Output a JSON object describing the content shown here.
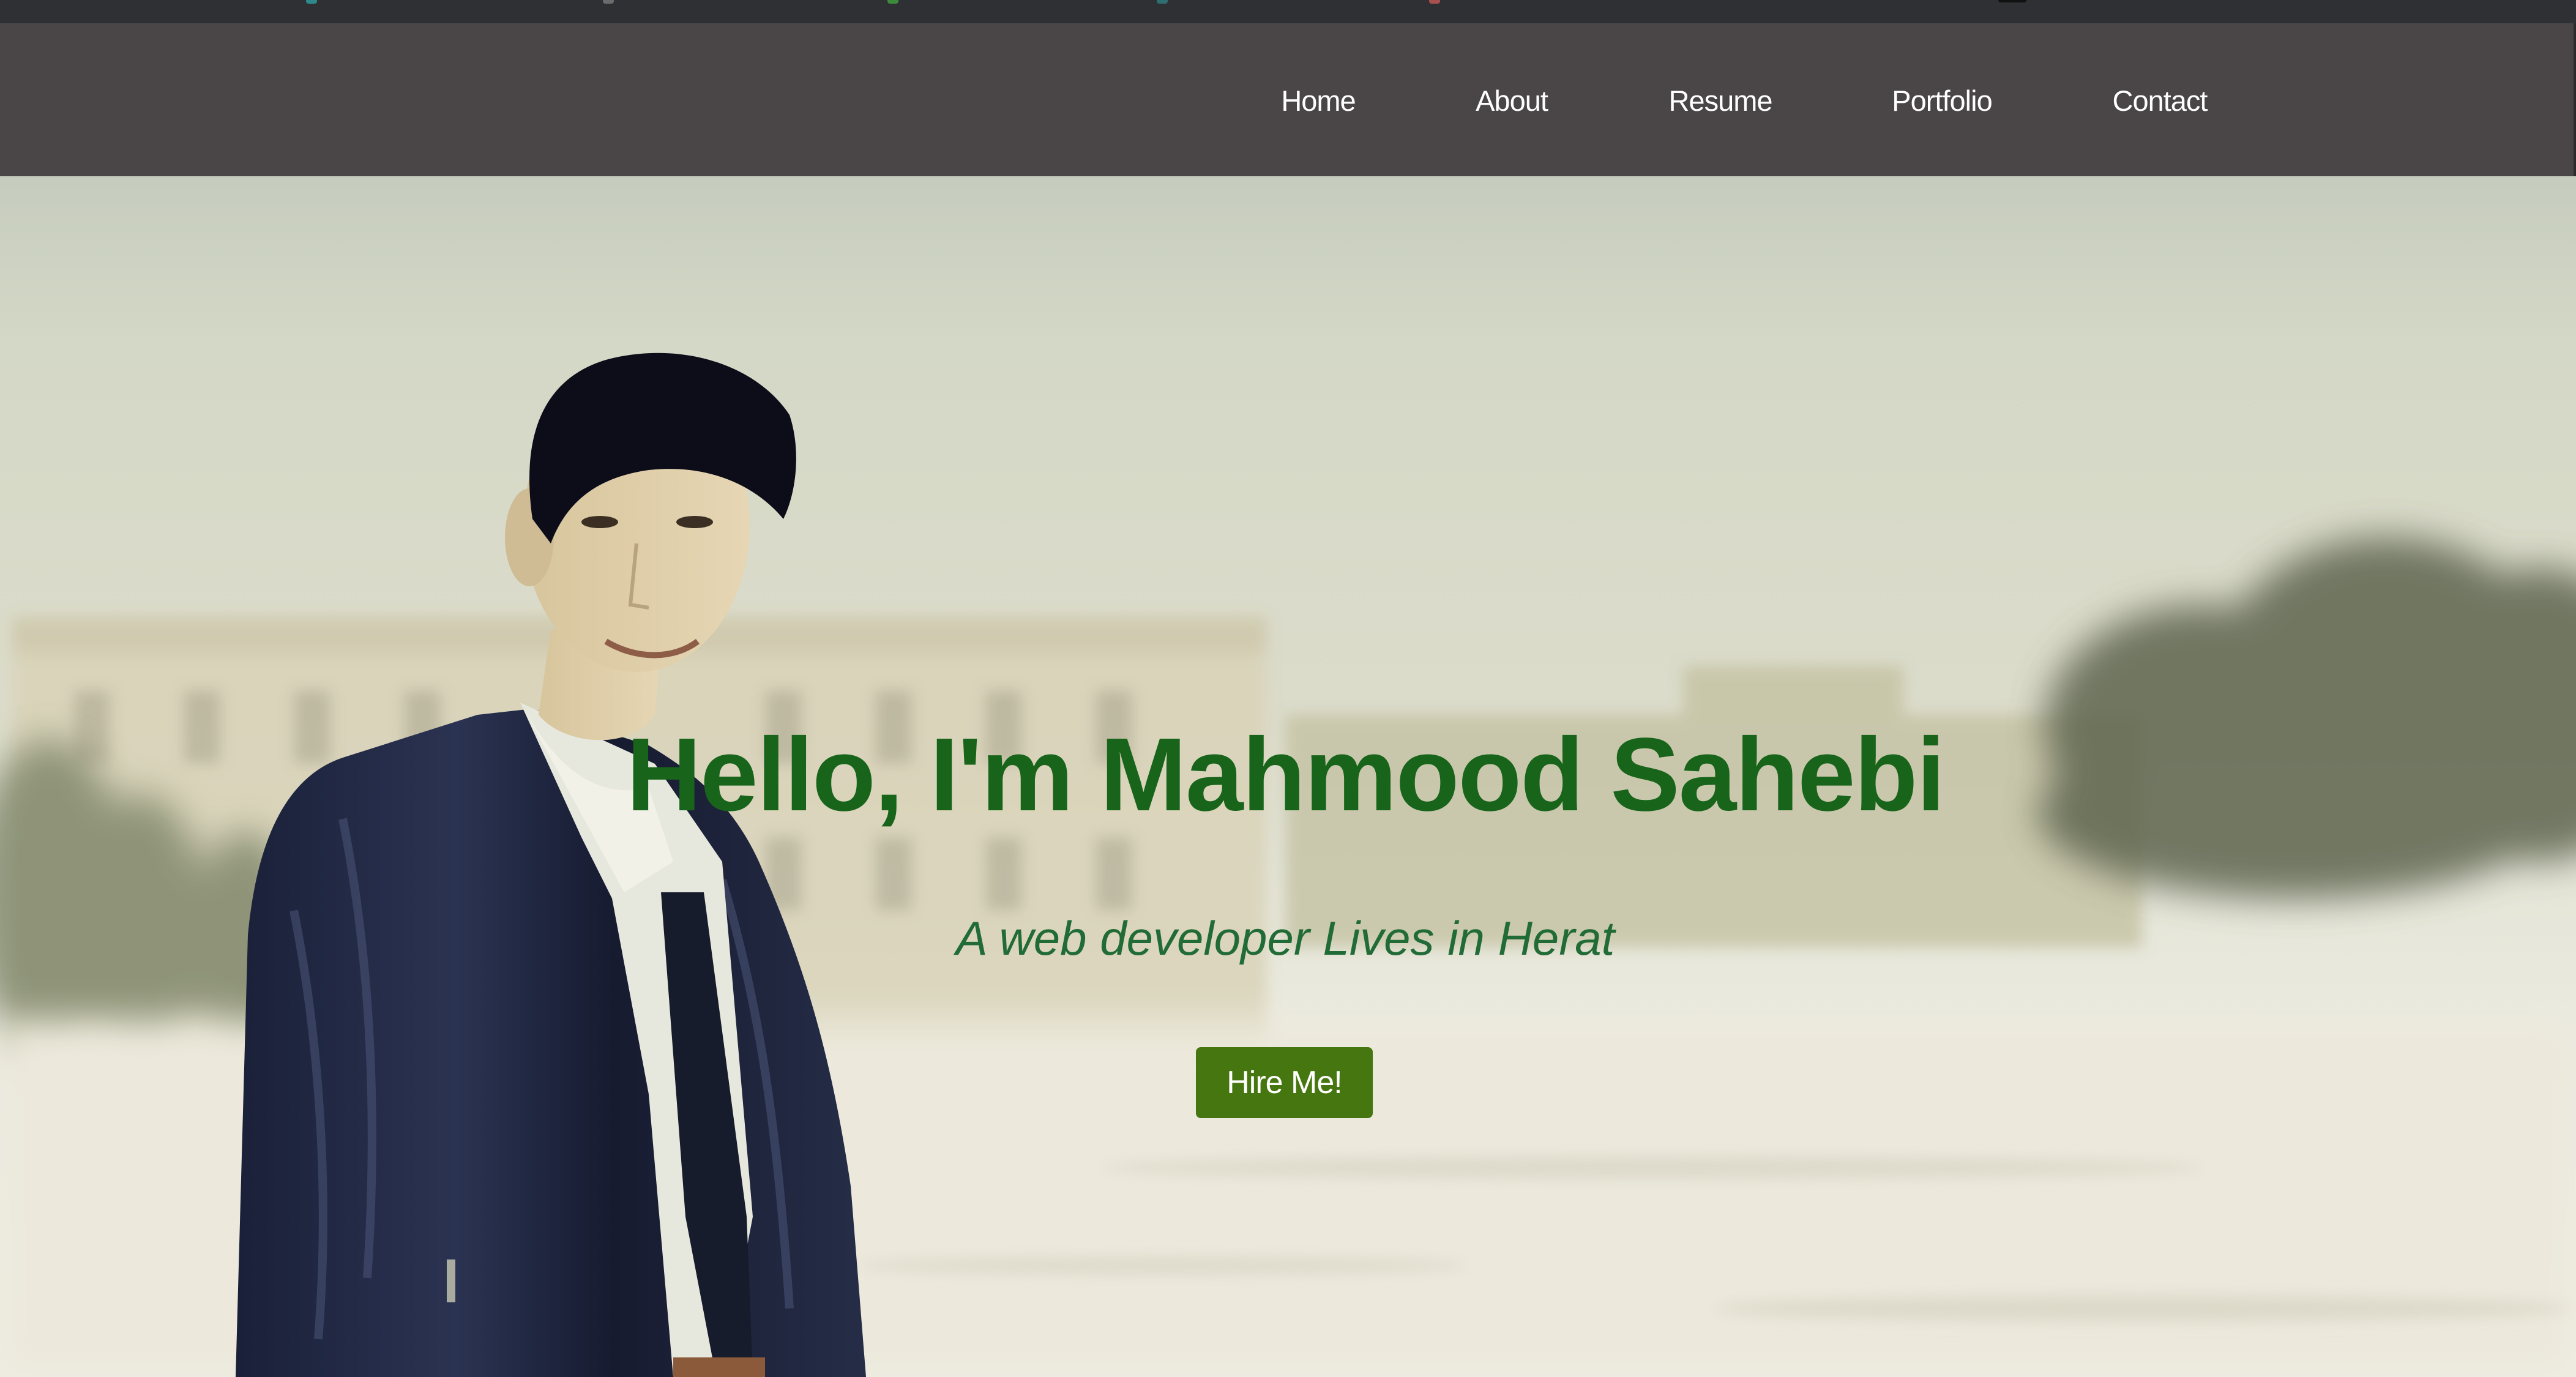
{
  "nav": {
    "items": [
      {
        "label": "Home"
      },
      {
        "label": "About"
      },
      {
        "label": "Resume"
      },
      {
        "label": "Portfolio"
      },
      {
        "label": "Contact"
      }
    ]
  },
  "hero": {
    "title": "Hello, I'm Mahmood Sahebi",
    "subtitle": "A web developer Lives in Herat",
    "cta_label": "Hire Me!"
  },
  "colors": {
    "navbar_bg": "#4a4648",
    "title": "#17641a",
    "subtitle": "#216b36",
    "button_bg": "#46760f"
  }
}
